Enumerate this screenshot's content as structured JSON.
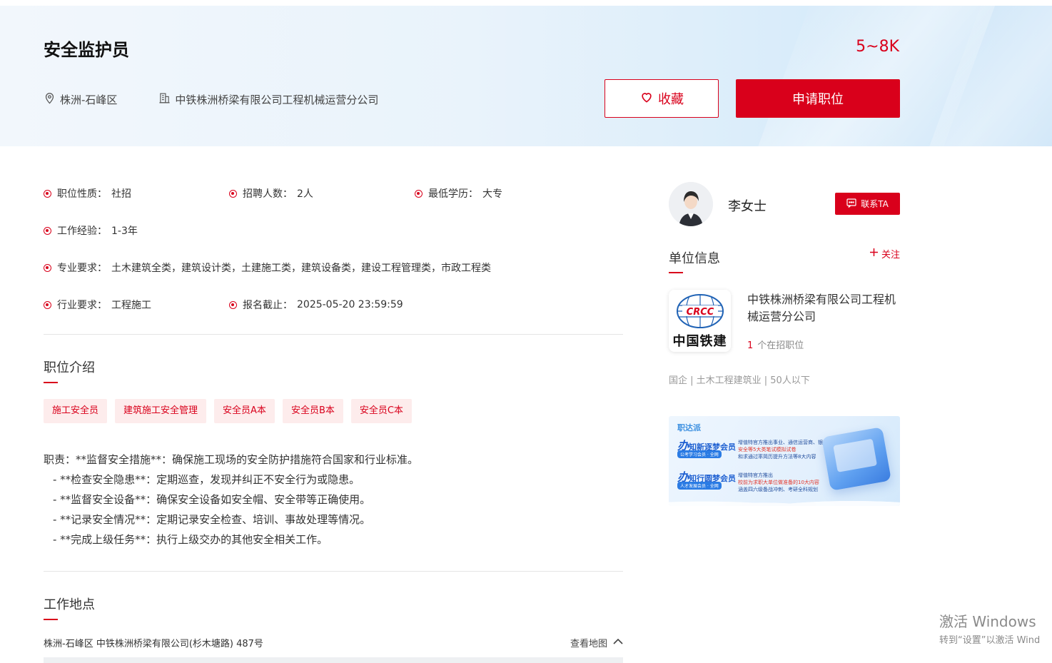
{
  "job": {
    "title": "安全监护员",
    "salary": "5~8K",
    "location": "株洲-石峰区",
    "company": "中铁株洲桥梁有限公司工程机械运营分公司",
    "fav_label": "收藏",
    "apply_label": "申请职位"
  },
  "attributes": {
    "nature": {
      "key": "职位性质：",
      "value": "社招"
    },
    "headcount": {
      "key": "招聘人数：",
      "value": "2人"
    },
    "education": {
      "key": "最低学历：",
      "value": "大专"
    },
    "experience": {
      "key": "工作经验：",
      "value": "1-3年"
    },
    "major": {
      "key": "专业要求：",
      "value": "土木建筑全类，建筑设计类，土建施工类，建筑设备类，建设工程管理类，市政工程类"
    },
    "industry": {
      "key": "行业要求：",
      "value": "工程施工"
    },
    "deadline": {
      "key": "报名截止：",
      "value": "2025-05-20 23:59:59"
    }
  },
  "intro": {
    "title": "职位介绍",
    "tags": [
      "施工安全员",
      "建筑施工安全管理",
      "安全员A本",
      "安全员B本",
      "安全员C本"
    ],
    "lines": [
      "职责：**监督安全措施**：确保施工现场的安全防护措施符合国家和行业标准。",
      "- **检查安全隐患**：定期巡查，发现并纠正不安全行为或隐患。",
      "- **监督安全设备**：确保安全设备如安全帽、安全带等正确使用。",
      "- **记录安全情况**：定期记录安全检查、培训、事故处理等情况。",
      "- **完成上级任务**：执行上级交办的其他安全相关工作。"
    ]
  },
  "work_place": {
    "title": "工作地点",
    "address": "株洲-石峰区 中铁株洲桥梁有限公司(杉木塘路) 487号",
    "map_link": "查看地图"
  },
  "recruiter": {
    "name": "李女士",
    "contact_label": "联系TA"
  },
  "unit": {
    "title": "单位信息",
    "follow_label": "关注",
    "logo_text": "中国铁建",
    "logo_mark": "CRCC",
    "company_name": "中铁株洲桥梁有限公司工程机械运营分公司",
    "openings_count": "1",
    "openings_label": "个在招职位",
    "tags": "国企 | 土木工程建筑业 | 50人以下"
  },
  "banner": {
    "brand": "职达派",
    "row1_prefix": "办",
    "row1_title": "知新逐梦会员",
    "row1_pill": "公考学习会员 · 全网",
    "row1_text1": "增值特官方推出事业、通信运营商、银行、烟草、",
    "row1_text2": "安全等5大类笔试模拟试卷",
    "row1_text3": "和求通过率简历提升方法等8大内容",
    "row2_prefix": "办",
    "row2_title": "知行圆梦会员",
    "row2_pill": "人才发展会员 · 全网",
    "row2_text1": "增值特官方推出",
    "row2_text2": "校前为求职大单位做准备的10大内容",
    "row2_text3": "涵盖四六级备战冲刺、考研全科规划"
  },
  "watermark": {
    "line1": "激活 Windows",
    "line2": "转到“设置”以激活 Wind"
  },
  "colors": {
    "accent": "#d9001b",
    "tag_bg": "#fdecec"
  }
}
